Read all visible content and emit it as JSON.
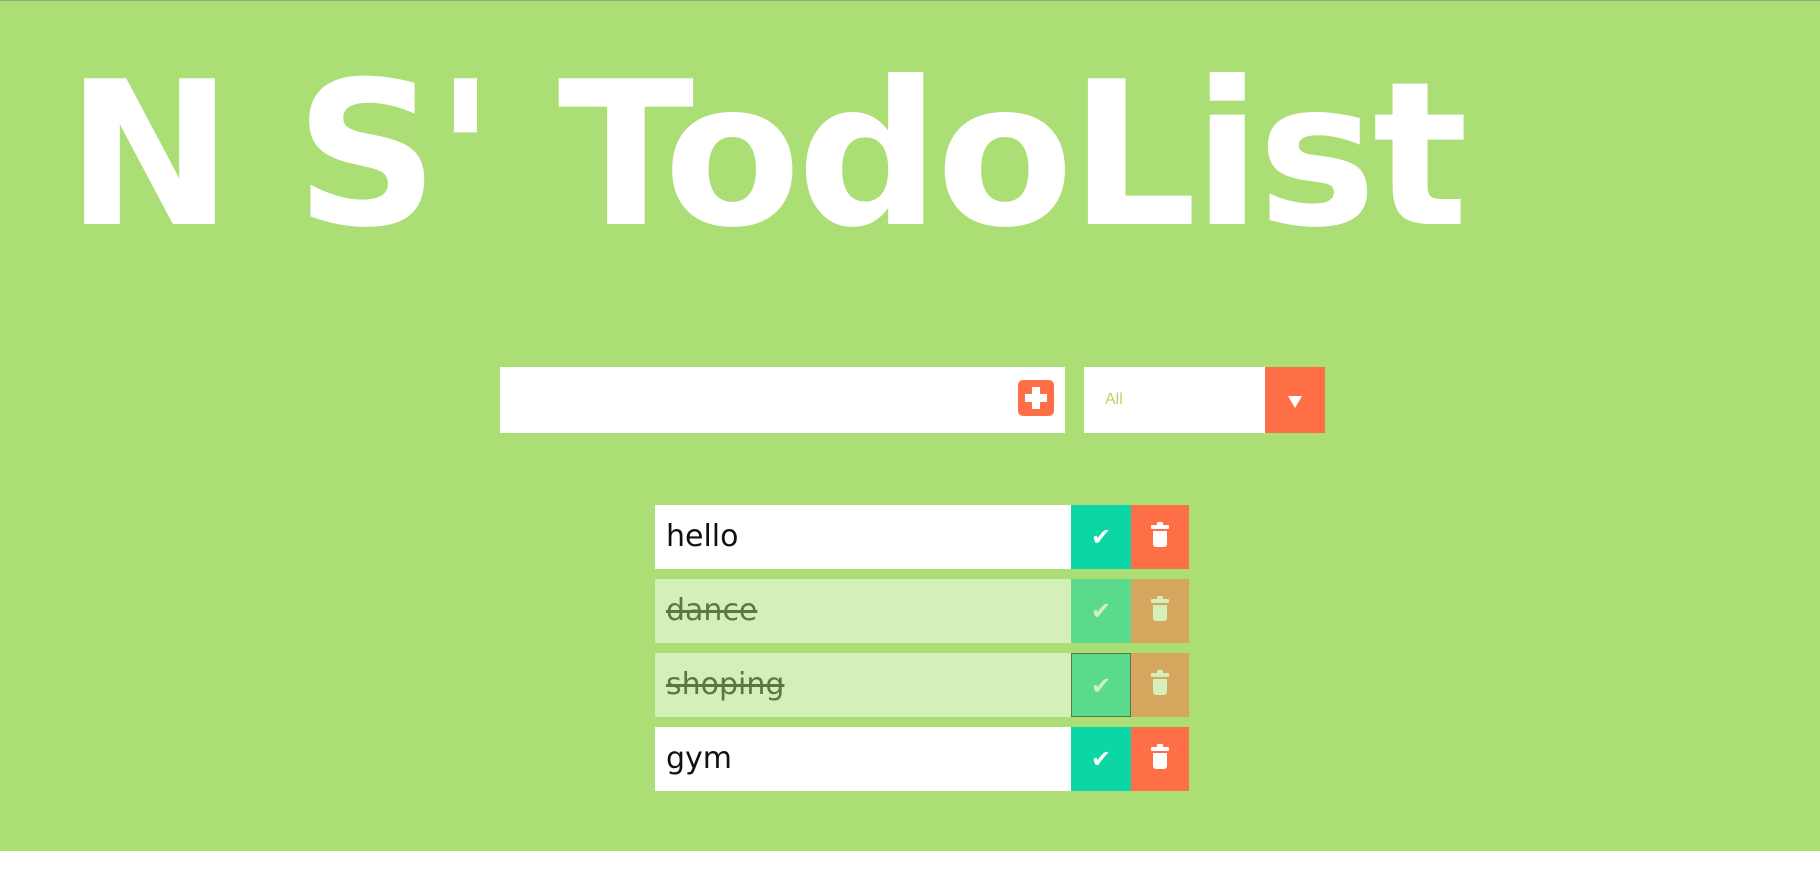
{
  "app": {
    "title": "N S' TodoList",
    "background_color": "#abdf75",
    "accent_color": "#ff6f47",
    "complete_color": "#0cd6a6"
  },
  "form": {
    "input_value": "",
    "add_icon": "plus-square-icon",
    "filter": {
      "selected": "All",
      "arrow_icon": "triangle-down-icon"
    }
  },
  "todos": [
    {
      "text": "hello",
      "completed": false
    },
    {
      "text": "dance",
      "completed": true
    },
    {
      "text": "shoping",
      "completed": true
    },
    {
      "text": "gym",
      "completed": false
    }
  ],
  "icons": {
    "complete": "check-icon",
    "delete": "trash-icon"
  }
}
